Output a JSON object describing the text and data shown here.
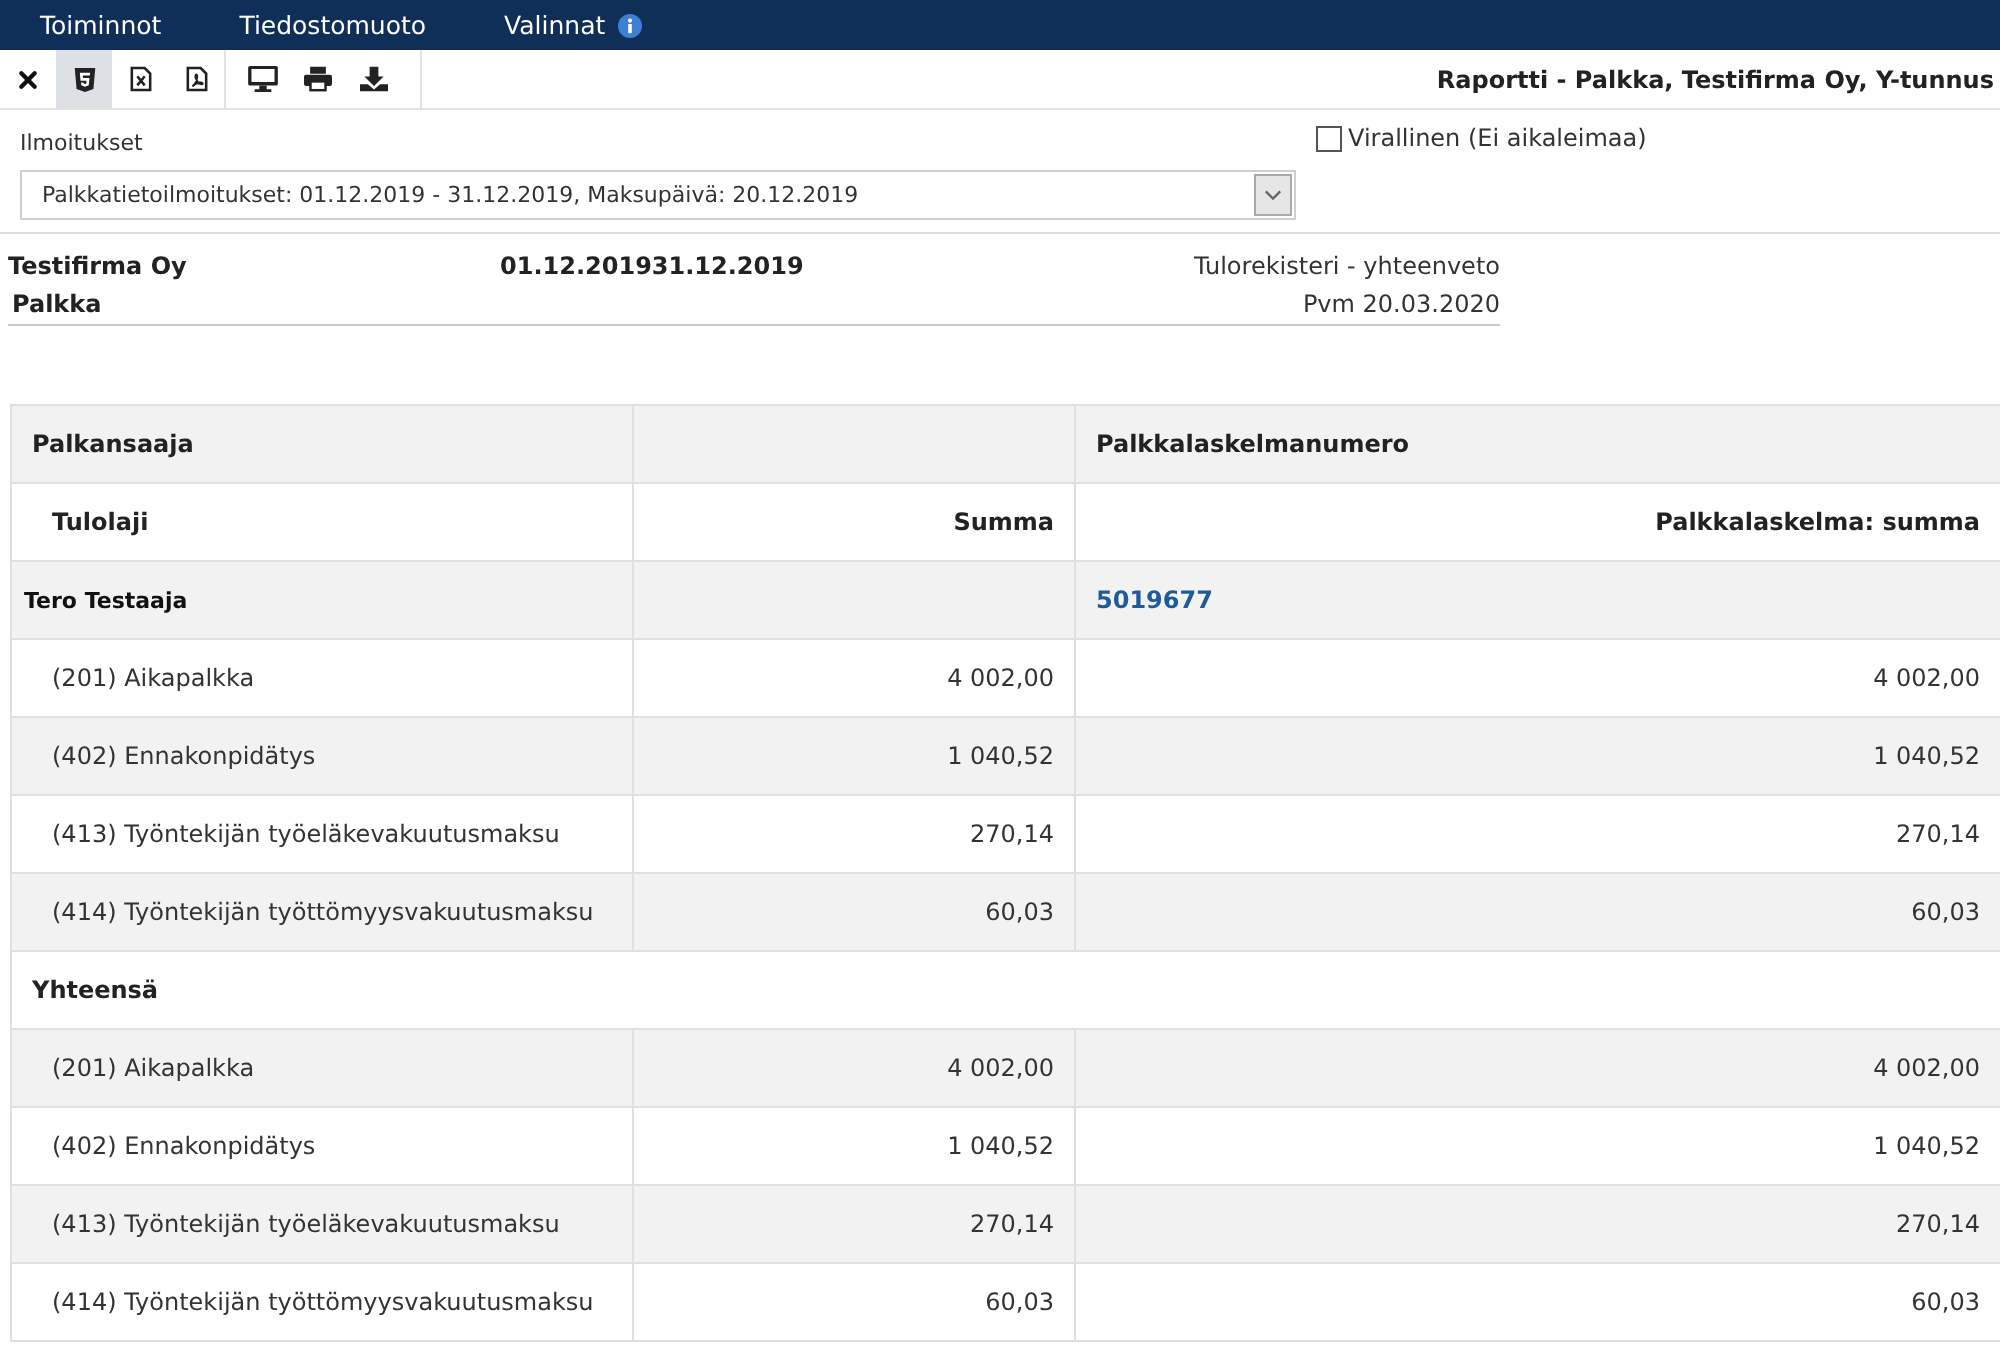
{
  "menu": [
    {
      "label": "Toiminnot",
      "info_icon": false
    },
    {
      "label": "Tiedostomuoto",
      "info_icon": false
    },
    {
      "label": "Valinnat",
      "info_icon": true
    }
  ],
  "toolbar": {
    "groups": [
      {
        "buttons": [
          {
            "kind": "close",
            "selected": false
          },
          {
            "kind": "html",
            "selected": true
          },
          {
            "kind": "excel",
            "selected": false
          },
          {
            "kind": "pdf",
            "selected": false
          }
        ]
      },
      {
        "buttons": [
          {
            "kind": "screen",
            "selected": false
          },
          {
            "kind": "print",
            "selected": false
          },
          {
            "kind": "download",
            "selected": false
          }
        ]
      }
    ],
    "title": "Raportti - Palkka, Testifirma Oy, Y-tunnus"
  },
  "filters": {
    "notifications": {
      "label": "Ilmoitukset",
      "value": "Palkkatietoilmoitukset: 01.12.2019 - 31.12.2019, Maksupäivä: 20.12.2019"
    },
    "official": {
      "label": "Virallinen (Ei aikaleimaa)",
      "checked": false
    }
  },
  "report_header": {
    "company": "Testifirma Oy",
    "period": "01.12.201931.12.2019",
    "report_type": "Tulorekisteri - yhteenveto",
    "subject": "Palkka",
    "date": "Pvm 20.03.2020"
  },
  "table": {
    "header_row_1": {
      "column_1": "Palkansaaja",
      "column_3": "Palkkalaskelmanumero"
    },
    "header_row_2": {
      "column_1": "Tulolaji",
      "column_2": "Summa",
      "column_3": "Palkkalaskelma: summa"
    },
    "rows": [
      {
        "kind": "person",
        "name": "Tero Testaaja",
        "payslip_number": "5019677"
      },
      {
        "kind": "item",
        "label": "(201) Aikapalkka",
        "sum": "4 002,00",
        "payslip_sum": "4 002,00"
      },
      {
        "kind": "item",
        "label": "(402) Ennakonpidätys",
        "sum": "1 040,52",
        "payslip_sum": "1 040,52"
      },
      {
        "kind": "item",
        "label": "(413) Työntekijän työeläkevakuutusmaksu",
        "sum": "270,14",
        "payslip_sum": "270,14"
      },
      {
        "kind": "item",
        "label": "(414) Työntekijän työttömyysvakuutusmaksu",
        "sum": "60,03",
        "payslip_sum": "60,03"
      },
      {
        "kind": "total",
        "label": "Yhteensä"
      },
      {
        "kind": "item",
        "label": "(201) Aikapalkka",
        "sum": "4 002,00",
        "payslip_sum": "4 002,00"
      },
      {
        "kind": "item",
        "label": "(402) Ennakonpidätys",
        "sum": "1 040,52",
        "payslip_sum": "1 040,52"
      },
      {
        "kind": "item",
        "label": "(413) Työntekijän työeläkevakuutusmaksu",
        "sum": "270,14",
        "payslip_sum": "270,14"
      },
      {
        "kind": "item",
        "label": "(414) Työntekijän työttömyysvakuutusmaksu",
        "sum": "60,03",
        "payslip_sum": "60,03"
      }
    ]
  }
}
